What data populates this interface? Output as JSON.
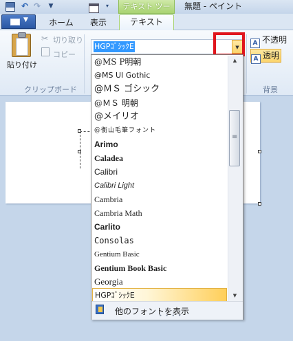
{
  "window": {
    "context_tab_group": "テキスト ツール",
    "title": "無題 - ペイント"
  },
  "tabs": [
    {
      "label": "ホーム"
    },
    {
      "label": "表示"
    },
    {
      "label": "テキスト"
    }
  ],
  "clipboard": {
    "paste_label": "貼り付け",
    "cut_label": "切り取り",
    "copy_label": "コピー",
    "group_label": "クリップボード"
  },
  "font": {
    "current_value": "HGPｺﾞｼｯｸE"
  },
  "background": {
    "opaque_label": "不透明",
    "transparent_label": "透明",
    "group_label": "背景"
  },
  "font_list": {
    "items": [
      {
        "label": "@MS P明朝"
      },
      {
        "label": "@MS UI Gothic"
      },
      {
        "label": "@ＭＳ ゴシック"
      },
      {
        "label": "@ＭＳ 明朝"
      },
      {
        "label": "@メイリオ"
      },
      {
        "label": "@衡山毛筆フォント"
      },
      {
        "label": "Arimo"
      },
      {
        "label": "Caladea"
      },
      {
        "label": "Calibri"
      },
      {
        "label": "Calibri Light"
      },
      {
        "label": "Cambria"
      },
      {
        "label": "Cambria Math"
      },
      {
        "label": "Carlito"
      },
      {
        "label": "Consolas"
      },
      {
        "label": "Gentium Basic"
      },
      {
        "label": "Gentium Book Basic"
      },
      {
        "label": "Georgia"
      },
      {
        "label": "HGPｺﾞｼｯｸE"
      }
    ],
    "more_fonts_label": "他のフォントを表示"
  },
  "colors": {
    "highlight": "#e0161d",
    "selection": "#3399ff",
    "context_tab": "#a9d372"
  }
}
